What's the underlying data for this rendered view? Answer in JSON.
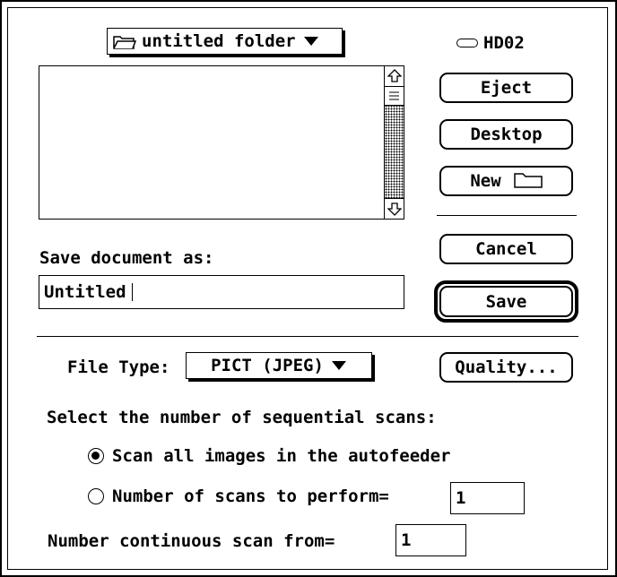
{
  "folder_popup": {
    "label": "untitled folder",
    "icon": "open-folder-icon"
  },
  "volume": {
    "label": "HD02",
    "icon": "hard-disk-icon"
  },
  "buttons": {
    "eject": "Eject",
    "desktop": "Desktop",
    "new": "New",
    "cancel": "Cancel",
    "save": "Save",
    "quality": "Quality..."
  },
  "save_as": {
    "label": "Save document as:",
    "value": "Untitled"
  },
  "file_type": {
    "label": "File Type:",
    "value": "PICT (JPEG)"
  },
  "scans": {
    "heading": "Select the number of sequential scans:",
    "options": [
      {
        "label": "Scan all images in the autofeeder",
        "selected": true
      },
      {
        "label": "Number of scans to perform=",
        "selected": false,
        "value": "1"
      }
    ],
    "continuous_label": "Number continuous scan from=",
    "continuous_value": "1"
  },
  "colors": {
    "foreground": "#000000",
    "background": "#ffffff"
  }
}
